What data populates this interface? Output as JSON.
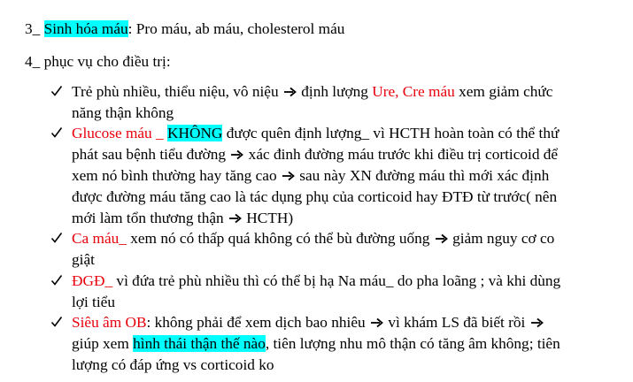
{
  "colors": {
    "red": "#e8000b",
    "highlight": "#00ffff",
    "text": "#000000"
  },
  "icons": {
    "check": "check-mark-icon",
    "arrow": "right-arrow-icon"
  },
  "section3": {
    "prefix": "3_ ",
    "highlight": "Sinh hóa máu",
    "rest": ": Pro máu, ab máu, cholesterol máu"
  },
  "section4": {
    "heading": "4_ phục vụ cho điều trị:"
  },
  "items": [
    {
      "l1a": "Trẻ phù nhiều, thiểu niệu, vô niệu",
      "l1b": "định lượng",
      "l1red": "Ure, Cre máu",
      "l1c": "xem giảm chức",
      "l2": "năng thận không"
    },
    {
      "l1red": "Glucose máu _",
      "l1hl": "KHÔNG",
      "l1c": "được quên định lượng_ vì HCTH hoàn toàn có thể thứ",
      "l2a": "phát sau bệnh tiểu đường",
      "l2b": "xác đinh đường máu trước khi điều trị corticoid để",
      "l3a": "xem nó bình thường hay tăng cao",
      "l3b": "sau này XN đường máu thì mới xác định",
      "l4": "được đường máu tăng cao là tác dụng phụ của corticoid hay ĐTĐ từ trước( nên",
      "l5a": "mới làm tổn thương thận",
      "l5b": "HCTH)"
    },
    {
      "l1red": "Ca máu_",
      "l1a": "xem nó có thấp quá không có thể bù đường uống",
      "l1b": "giảm nguy cơ co",
      "l2": "giật"
    },
    {
      "l1red": "ĐGĐ_",
      "l1a": "vì đứa trẻ phù nhiều thì có thể bị hạ Na máu_ do pha loãng ; và khi dùng",
      "l2": "lợi tiểu"
    },
    {
      "l1red": "Siêu âm OB",
      "l1a": ": không phải để xem dịch bao nhiêu",
      "l1b": "vì khám LS đã biết rồi",
      "l2a": "giúp xem",
      "l2hl": "hình thái thận thế nào",
      "l2b": ", tiên lượng nhu mô thận có tăng âm không; tiên",
      "l3": "lượng có đáp ứng vs corticoid ko"
    }
  ]
}
